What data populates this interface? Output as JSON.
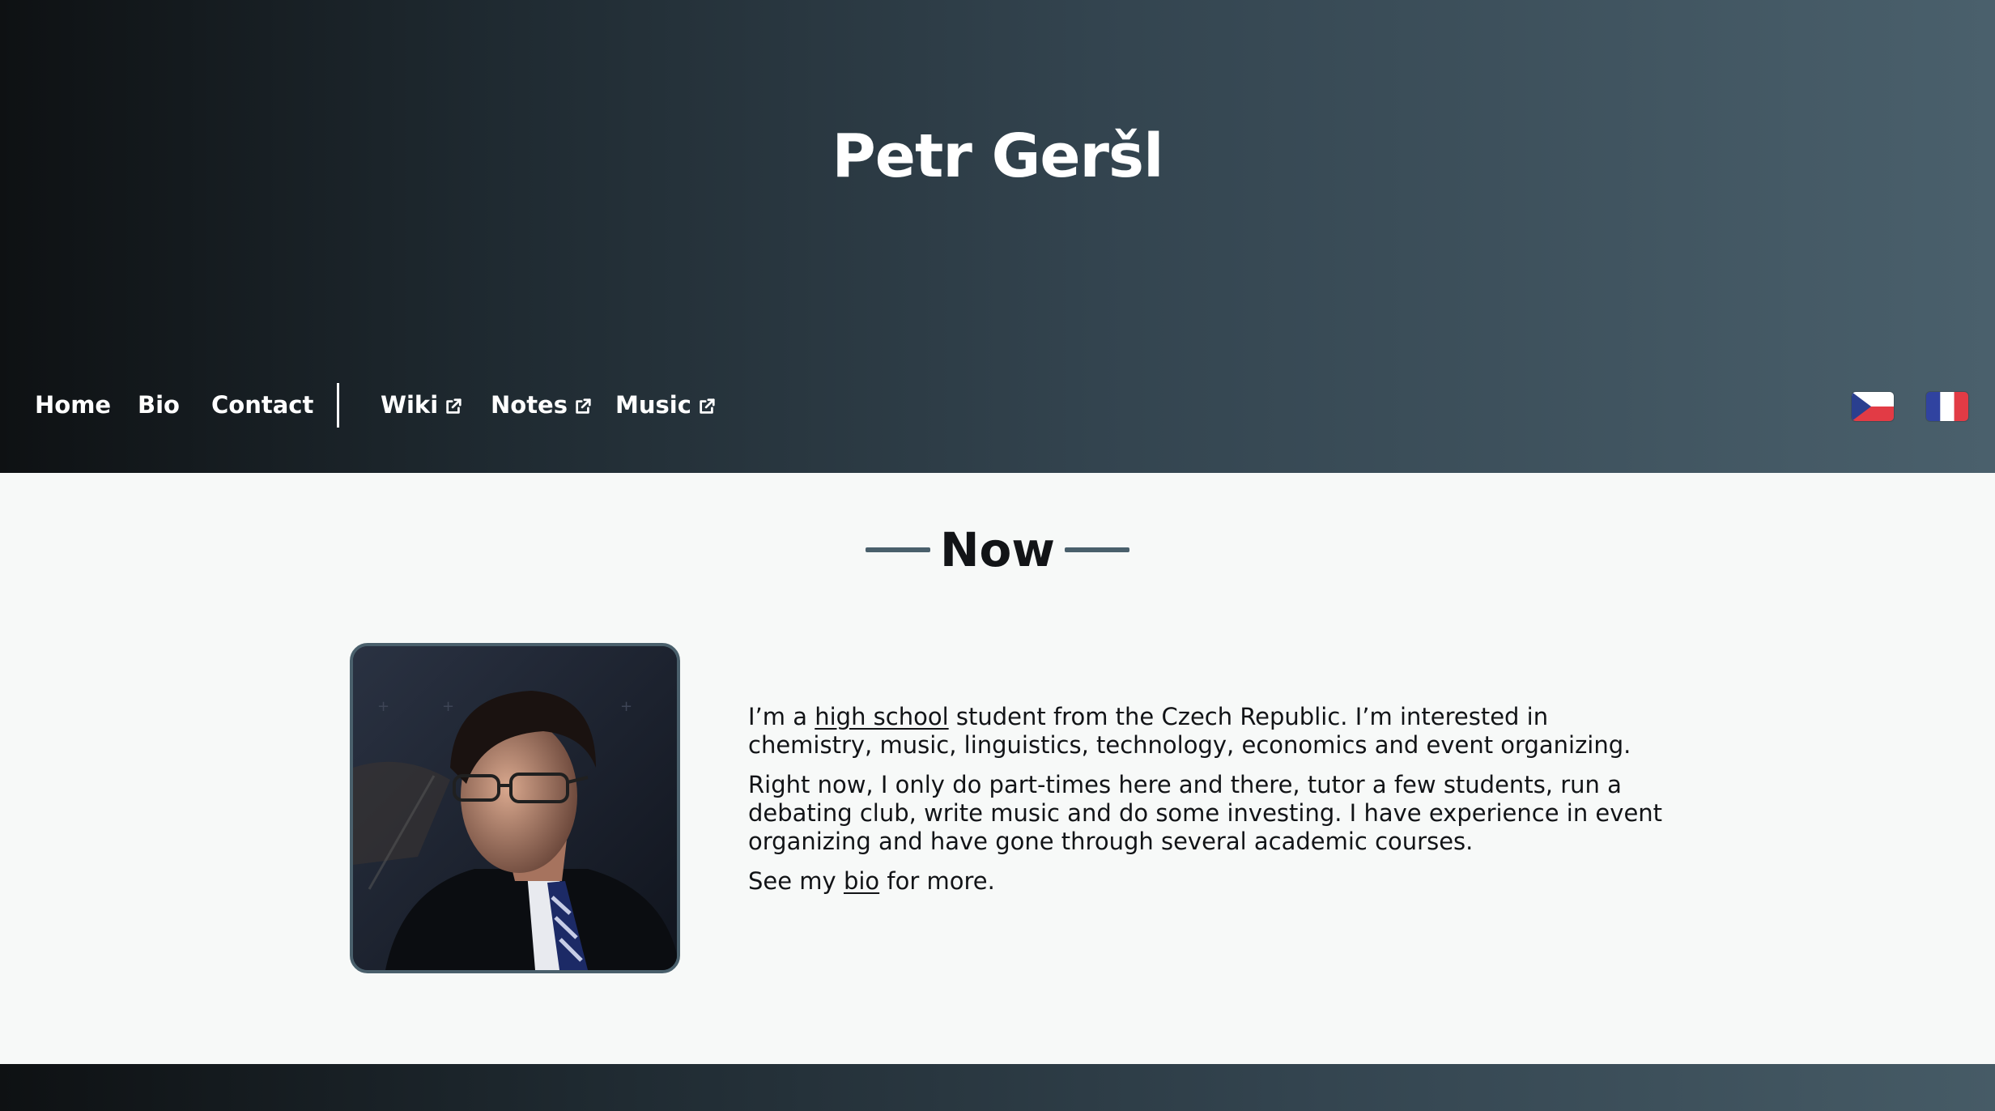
{
  "header": {
    "title": "Petr Geršl"
  },
  "nav": {
    "items": [
      {
        "label": "Home",
        "external": false
      },
      {
        "label": "Bio",
        "external": false
      },
      {
        "label": "Contact",
        "external": false
      },
      {
        "label": "Wiki",
        "external": true
      },
      {
        "label": "Notes",
        "external": true
      },
      {
        "label": "Music",
        "external": true
      }
    ],
    "languages": [
      {
        "icon": "czech-flag-icon"
      },
      {
        "icon": "french-flag-icon"
      }
    ]
  },
  "section": {
    "heading": "Now",
    "portrait_icon": "portrait-photo"
  },
  "bio": {
    "p1_prefix": "I’m a ",
    "p1_link": "high school",
    "p1_suffix": " student from the Czech Republic. I’m interested in chemistry, music, linguistics, technology, economics and event organizing.",
    "p2": "Right now, I only do part-times here and there, tutor a few students, run a debating club, write music and do some investing. I have experience in event organizing and have gone through several academic courses.",
    "p3_prefix": "See my ",
    "p3_link": "bio",
    "p3_suffix": " for more."
  },
  "colors": {
    "accent": "#4a606c",
    "text": "#121417",
    "background": "#f7f9f8"
  }
}
